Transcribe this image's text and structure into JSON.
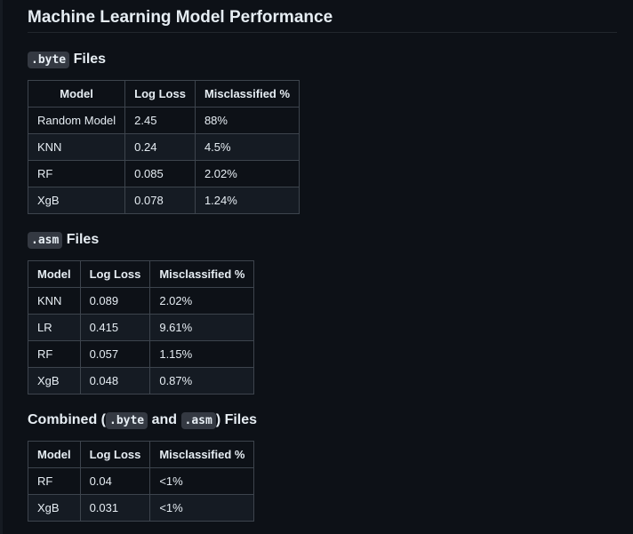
{
  "title": "Machine Learning Model Performance",
  "sections": [
    {
      "heading_code": ".byte",
      "heading_suffix": "Files",
      "columns": [
        "Model",
        "Log Loss",
        "Misclassified %"
      ],
      "rows": [
        [
          "Random Model",
          "2.45",
          "88%"
        ],
        [
          "KNN",
          "0.24",
          "4.5%"
        ],
        [
          "RF",
          "0.085",
          "2.02%"
        ],
        [
          "XgB",
          "0.078",
          "1.24%"
        ]
      ]
    },
    {
      "heading_code": ".asm",
      "heading_suffix": "Files",
      "columns": [
        "Model",
        "Log Loss",
        "Misclassified %"
      ],
      "rows": [
        [
          "KNN",
          "0.089",
          "2.02%"
        ],
        [
          "LR",
          "0.415",
          "9.61%"
        ],
        [
          "RF",
          "0.057",
          "1.15%"
        ],
        [
          "XgB",
          "0.048",
          "0.87%"
        ]
      ]
    },
    {
      "heading_prefix": "Combined (",
      "heading_code_1": ".byte",
      "heading_middle": "and",
      "heading_code_2": ".asm",
      "heading_suffix": ") Files",
      "columns": [
        "Model",
        "Log Loss",
        "Misclassified %"
      ],
      "rows": [
        [
          "RF",
          "0.04",
          "<1%"
        ],
        [
          "XgB",
          "0.031",
          "<1%"
        ]
      ]
    }
  ]
}
